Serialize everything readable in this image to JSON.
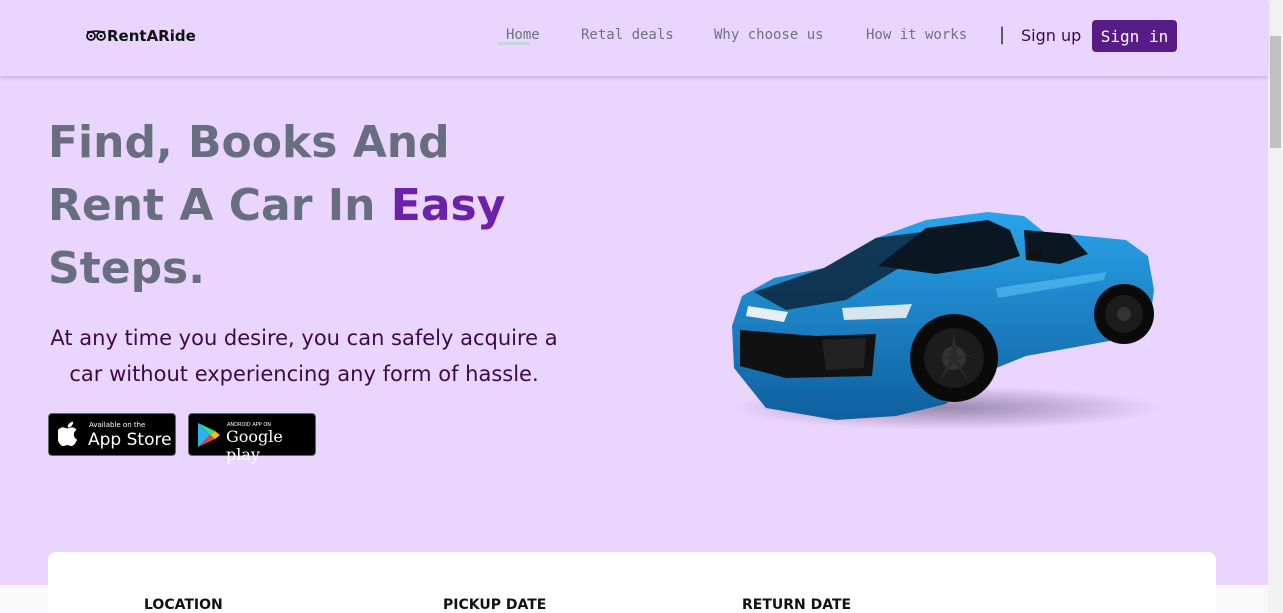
{
  "header": {
    "logo_text": "RentARide",
    "nav": [
      {
        "label": "Home"
      },
      {
        "label": "Retal deals"
      },
      {
        "label": "Why choose us"
      },
      {
        "label": "How it works"
      }
    ],
    "separator": "|",
    "signup_label": "Sign up",
    "signin_label": "Sign in"
  },
  "hero": {
    "title_part1": "Find, Books And",
    "title_part2": "Rent A Car In ",
    "title_highlight": "Easy",
    "title_part3": "Steps.",
    "subtitle": "At any time you desire, you can safely acquire a car without experiencing any form of hassle."
  },
  "stores": {
    "apple": {
      "small": "Available on the",
      "big": "App Store"
    },
    "google": {
      "small": "ANDROID APP ON",
      "big": "Google play"
    }
  },
  "booking": {
    "location_label": "LOCATION",
    "pickup_label": "PICKUP DATE",
    "return_label": "RETURN DATE"
  },
  "colors": {
    "background": "#ead5fe",
    "accent": "#581c87",
    "highlight": "#6b21a8",
    "title": "#676e80",
    "car_body": "#1f8fd6"
  }
}
